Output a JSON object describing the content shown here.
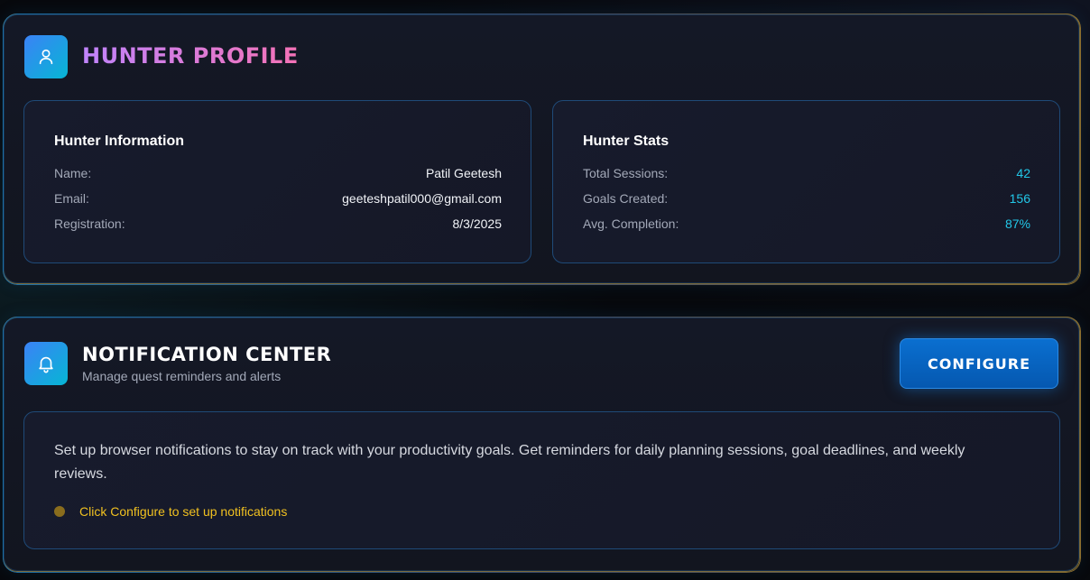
{
  "profile": {
    "title": "HUNTER PROFILE",
    "info": {
      "title": "Hunter Information",
      "rows": [
        {
          "label": "Name:",
          "value": "Patil Geetesh"
        },
        {
          "label": "Email:",
          "value": "geeteshpatil000@gmail.com"
        },
        {
          "label": "Registration:",
          "value": "8/3/2025"
        }
      ]
    },
    "stats": {
      "title": "Hunter Stats",
      "rows": [
        {
          "label": "Total Sessions:",
          "value": "42"
        },
        {
          "label": "Goals Created:",
          "value": "156"
        },
        {
          "label": "Avg. Completion:",
          "value": "87%"
        }
      ]
    },
    "icon": "user-icon"
  },
  "notifications": {
    "title": "NOTIFICATION CENTER",
    "subtitle": "Manage quest reminders and alerts",
    "configure_label": "CONFIGURE",
    "description": "Set up browser notifications to stay on track with your productivity goals. Get reminders for daily planning sessions, goal deadlines, and weekly reviews.",
    "hint": "Click Configure to set up notifications",
    "icon": "bell-icon"
  },
  "colors": {
    "accent_cyan": "#22c7e8",
    "button_blue": "#0a6fd0",
    "hint_yellow": "#f0c020"
  }
}
